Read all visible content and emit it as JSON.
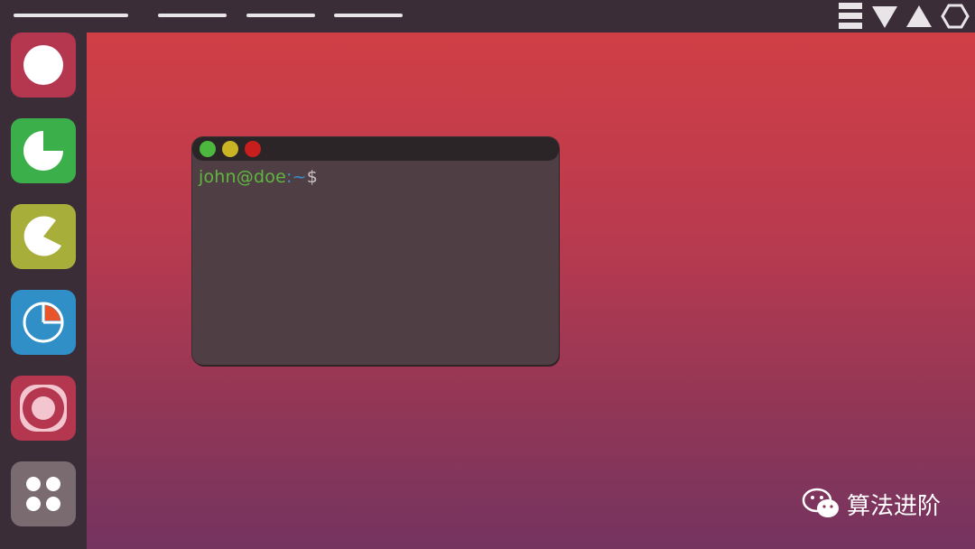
{
  "topbar": {
    "tray_icons": [
      "menu-lines-icon",
      "triangle-down-icon",
      "triangle-up-icon",
      "hexagon-icon"
    ]
  },
  "dock": {
    "items": [
      {
        "icon": "circle-icon",
        "color": "#b5364f"
      },
      {
        "icon": "pie-chart-icon",
        "color": "#3aaf4a"
      },
      {
        "icon": "pacman-icon",
        "color": "#a8ae3a"
      },
      {
        "icon": "pie-chart-orange-icon",
        "color": "#2f8fc6"
      },
      {
        "icon": "target-icon",
        "color": "#b5364f"
      },
      {
        "icon": "dots-grid-icon",
        "color": "#7a6b70"
      }
    ]
  },
  "terminal": {
    "buttons": {
      "green": "#4cb83e",
      "yellow": "#c9b424",
      "red": "#c81e1e"
    },
    "prompt": {
      "user": "john@doe",
      "separator": ":",
      "path": "~",
      "symbol": "$"
    }
  },
  "watermark": {
    "text": "算法进阶",
    "icon": "wechat-icon"
  },
  "colors": {
    "desktop_top": "#d03f45",
    "desktop_bottom": "#743460",
    "panel": "#3a2d37"
  }
}
